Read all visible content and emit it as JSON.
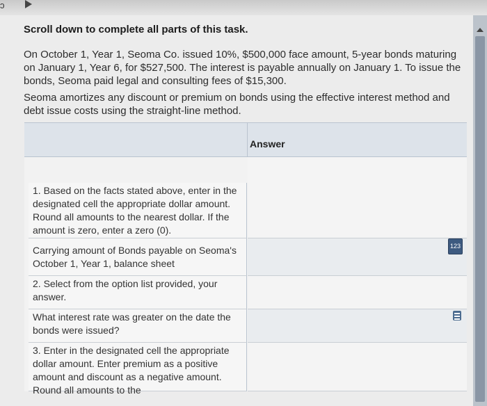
{
  "task": {
    "heading": "Scroll down to complete all parts of this task.",
    "paragraph1": "On October 1, Year 1, Seoma Co. issued 10%, $500,000 face amount, 5-year bonds maturing on January 1, Year 6, for $527,500. The interest is payable annually on January 1. To issue the bonds, Seoma paid legal and consulting fees of $15,300.",
    "paragraph2": "Seoma amortizes any discount or premium on bonds using the effective interest method and debt issue costs using the straight-line method."
  },
  "table": {
    "answer_header": "Answer",
    "rows": [
      {
        "label": "1. Based on the facts stated above, enter in the designated cell the appropriate dollar amount. Round all amounts to the nearest dollar. If the amount is zero, enter a zero (0)."
      },
      {
        "label": "Carrying amount of Bonds payable on Seoma's October 1, Year 1, balance sheet",
        "input_badge": "123"
      },
      {
        "label": "2. Select from the option list provided, your answer."
      },
      {
        "label": "What interest rate was greater on the date the bonds were issued?",
        "input_icon": "list-icon"
      },
      {
        "label": "3. Enter in the designated cell the appropriate dollar amount. Enter premium as a positive amount and discount as a negative amount. Round all amounts to the"
      }
    ]
  },
  "icons": {
    "scroll_up": "scroll-up-arrow-icon",
    "numeric_input": "123-badge-icon",
    "dropdown_input": "list-icon"
  }
}
